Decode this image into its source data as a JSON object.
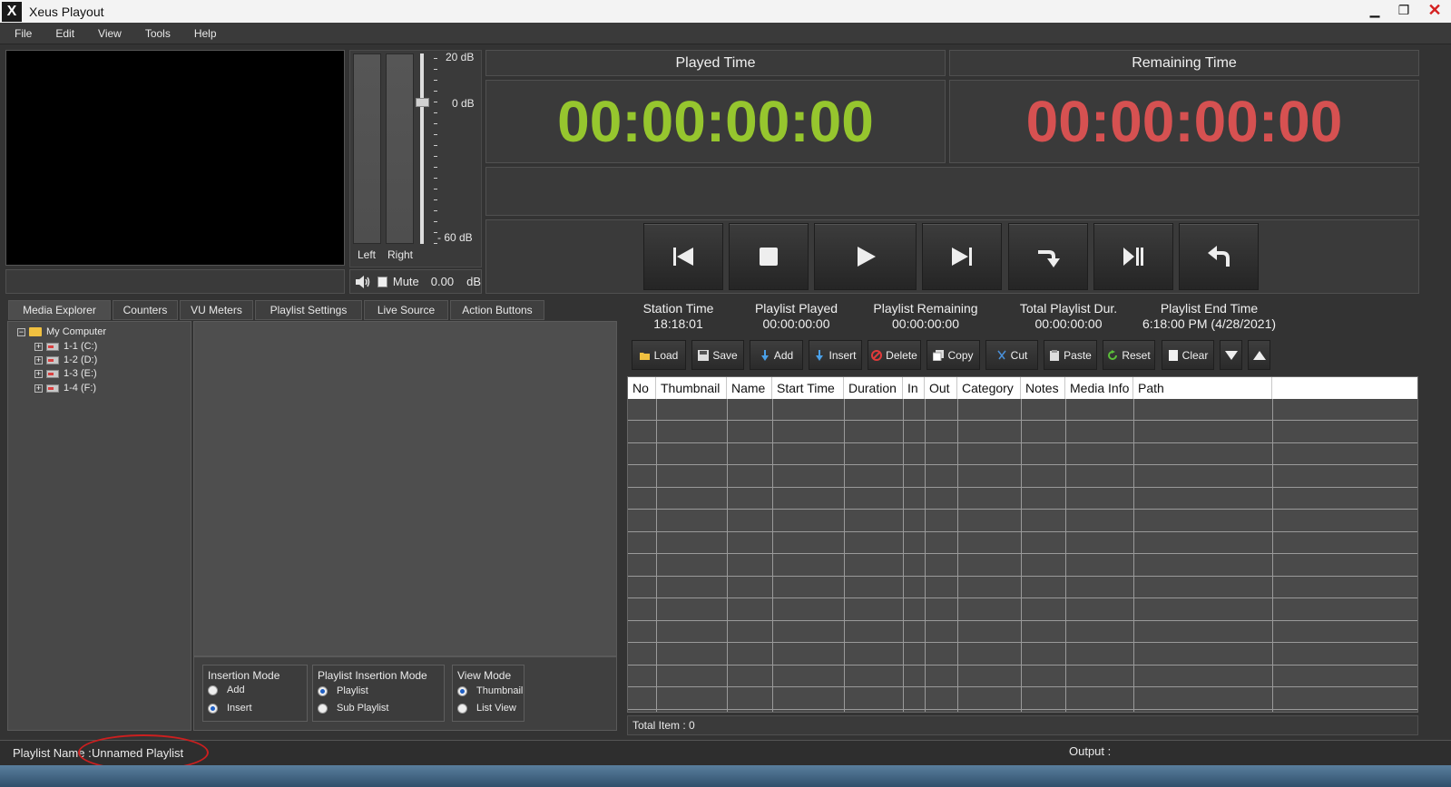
{
  "window": {
    "title": "Xeus Playout",
    "icon_glyph": "X"
  },
  "menu": [
    "File",
    "Edit",
    "View",
    "Tools",
    "Help"
  ],
  "vu": {
    "left_label": "Left",
    "right_label": "Right",
    "top_db": "20 dB",
    "zero_db": "0 dB",
    "bottom_db": "- 60 dB",
    "mute_label": "Mute",
    "volume_value": "0.00",
    "volume_unit": "dB"
  },
  "timers": {
    "played": {
      "label": "Played Time",
      "value": "00:00:00:00",
      "color": "#96c62e"
    },
    "remaining": {
      "label": "Remaining Time",
      "value": "00:00:00:00",
      "color": "#d65151"
    }
  },
  "transport_icons": [
    "skip-previous-icon",
    "stop-icon",
    "play-icon",
    "skip-next-icon",
    "jump-icon",
    "play-pause-icon",
    "undo-icon"
  ],
  "tabs": [
    "Media Explorer",
    "Counters",
    "VU Meters",
    "Playlist Settings",
    "Live Source",
    "Action Buttons"
  ],
  "tree": {
    "root": "My Computer",
    "drives": [
      "1-1 (C:)",
      "1-2 (D:)",
      "1-3 (E:)",
      "1-4 (F:)"
    ]
  },
  "insertion_mode": {
    "title": "Insertion Mode",
    "options": [
      "Add",
      "Insert"
    ],
    "selected": "Insert"
  },
  "playlist_insertion_mode": {
    "title": "Playlist Insertion Mode",
    "options": [
      "Playlist",
      "Sub Playlist"
    ],
    "selected": "Playlist"
  },
  "view_mode": {
    "title": "View Mode",
    "options": [
      "Thumbnail",
      "List View"
    ],
    "selected": "Thumbnail"
  },
  "stats": {
    "station_time": {
      "label": "Station Time",
      "value": "18:18:01"
    },
    "playlist_played": {
      "label": "Playlist Played",
      "value": "00:00:00:00"
    },
    "playlist_remaining": {
      "label": "Playlist Remaining",
      "value": "00:00:00:00"
    },
    "total_duration": {
      "label": "Total Playlist Dur.",
      "value": "00:00:00:00"
    },
    "end_time": {
      "label": "Playlist End Time",
      "value": "6:18:00 PM (4/28/2021)"
    }
  },
  "toolbar": {
    "load": "Load",
    "save": "Save",
    "add": "Add",
    "insert": "Insert",
    "delete": "Delete",
    "copy": "Copy",
    "cut": "Cut",
    "paste": "Paste",
    "reset": "Reset",
    "clear": "Clear"
  },
  "grid": {
    "columns": [
      "No",
      "Thumbnail",
      "Name",
      "Start Time",
      "Duration",
      "In",
      "Out",
      "Category",
      "Notes",
      "Media Info",
      "Path"
    ],
    "rows": []
  },
  "total_items": "Total Item : 0",
  "status": {
    "playlist_name_label": "Playlist Name :",
    "playlist_name": "Unnamed Playlist",
    "output_label": "Output :"
  },
  "colors": {
    "played": "#96c62e",
    "remaining": "#d65151",
    "annotation": "#cc1f1f"
  }
}
